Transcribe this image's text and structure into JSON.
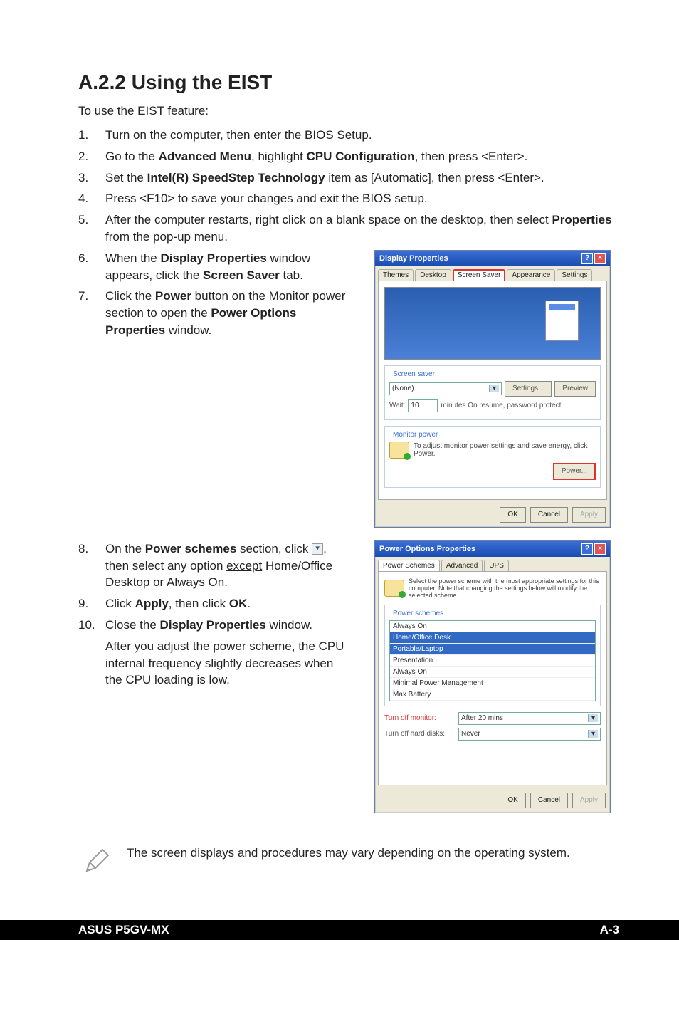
{
  "heading": "A.2.2   Using the EIST",
  "intro": "To use the EIST feature:",
  "steps1": {
    "1": {
      "t": "Turn on the computer, then enter the BIOS Setup."
    },
    "2": {
      "a": "Go to the ",
      "b": "Advanced Menu",
      "c": ", highlight ",
      "d": "CPU Configuration",
      "e": ", then press <Enter>."
    },
    "3": {
      "a": "Set the ",
      "b": "Intel(R) SpeedStep Technology",
      "c": " item as [Automatic], then press <Enter>."
    },
    "4": {
      "t": "Press <F10> to save your changes and exit the BIOS setup."
    },
    "5": {
      "a": "After the computer restarts, right click on a blank space on the desktop, then select ",
      "b": "Properties",
      "c": " from the pop-up menu."
    }
  },
  "steps2": {
    "6": {
      "a": "When the ",
      "b": "Display Properties",
      "c": " window appears, click the ",
      "d": "Screen Saver",
      "e": " tab."
    },
    "7": {
      "a": "Click the ",
      "b": "Power",
      "c": " button on the Monitor power section to open the ",
      "d": "Power Options Properties",
      "e": " window."
    }
  },
  "steps3": {
    "8": {
      "a": "On the ",
      "b": "Power schemes",
      "c": " section, click ",
      "d": ", then select any option ",
      "e": "except",
      "f": " Home/Office Desktop or Always On."
    },
    "9": {
      "a": "Click ",
      "b": "Apply",
      "c": ", then click ",
      "d": "OK",
      "e": "."
    },
    "10": {
      "a": "Close the ",
      "b": "Display Properties",
      "c": " window."
    },
    "after": "After you adjust the power scheme, the CPU internal frequency slightly decreases when the CPU loading is low."
  },
  "dlg1": {
    "title": "Display Properties",
    "tabs": [
      "Themes",
      "Desktop",
      "Screen Saver",
      "Appearance",
      "Settings"
    ],
    "legend_ss": "Screen saver",
    "ss_value": "(None)",
    "settings_btn": "Settings...",
    "preview_btn": "Preview",
    "wait_lbl": "Wait:",
    "wait_val": "10",
    "wait_suffix": "minutes  On resume, password protect",
    "legend_mp": "Monitor power",
    "mp_text": "To adjust monitor power settings and save energy, click Power.",
    "power_btn": "Power...",
    "ok": "OK",
    "cancel": "Cancel",
    "apply": "Apply"
  },
  "dlg2": {
    "title": "Power Options Properties",
    "tabs": [
      "Power Schemes",
      "Advanced",
      "UPS"
    ],
    "desc": "Select the power scheme with the most appropriate settings for this computer. Note that changing the settings below will modify the selected scheme.",
    "legend_ps": "Power schemes",
    "schemes": [
      "Always On",
      "Home/Office Desk",
      "Portable/Laptop",
      "Presentation",
      "Always On",
      "Minimal Power Management",
      "Max Battery"
    ],
    "turn_mon": "Turn off monitor:",
    "turn_mon_val": "After 20 mins",
    "turn_hd": "Turn off hard disks:",
    "turn_hd_val": "Never",
    "ok": "OK",
    "cancel": "Cancel",
    "apply": "Apply"
  },
  "note": "The screen displays and procedures may vary depending on the operating system.",
  "footer_left": "ASUS P5GV-MX",
  "footer_right": "A-3"
}
